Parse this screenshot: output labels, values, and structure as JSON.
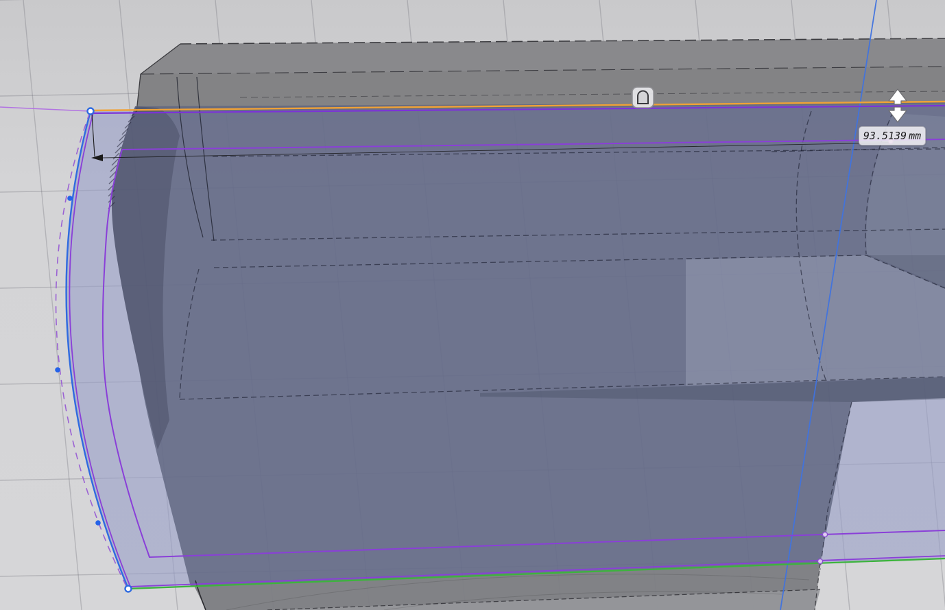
{
  "viewport": {
    "dimension_tooltip": {
      "value": "93.5139",
      "unit": "mm"
    },
    "constraint_badge": {
      "glyph": "tangent-dome"
    },
    "manipulator": {
      "type": "vertical-drag-arrow"
    }
  },
  "colors": {
    "background": "#d2d2d4",
    "grid_line": "#b4b4b8",
    "body_top_gray": "#89898c",
    "body_section_blue": "#757a91",
    "profile_light_blue": "#aeb3cd",
    "sketch_orange": "#f0a236",
    "sketch_purple": "#7c32d8",
    "sketch_violet_ext": "#b273e2",
    "construction_purple": "#9b62d4",
    "sketch_blue": "#2f6be0",
    "axis_blue": "#4073e0",
    "sketch_green": "#3cb43c",
    "dimension_black": "#1a1a1a",
    "anchor_pink": "#edb6e6"
  }
}
